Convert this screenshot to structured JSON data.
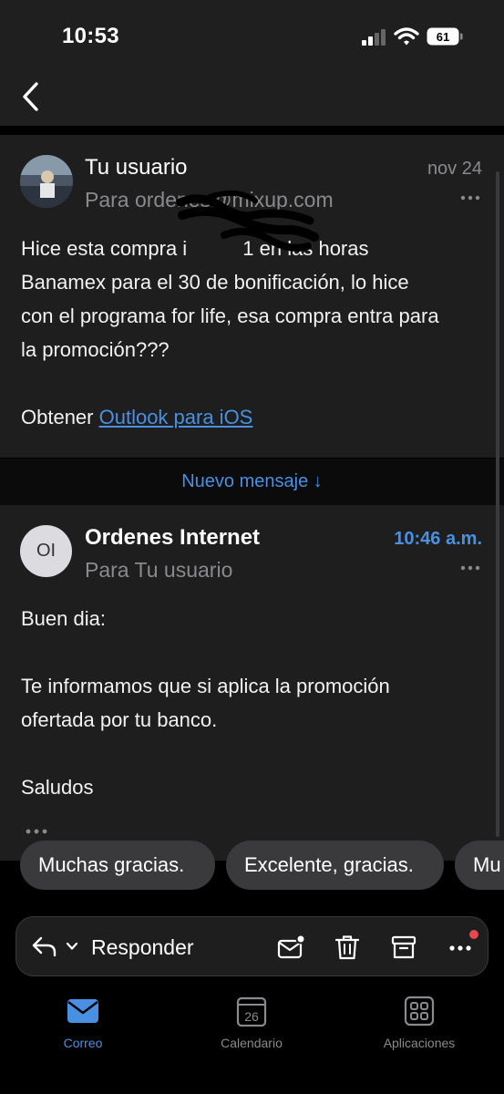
{
  "status_bar": {
    "time": "10:53",
    "battery": "61"
  },
  "messages": [
    {
      "sender": "Tu usuario",
      "recipient": "Para ordenes@mixup.com",
      "date": "nov 24",
      "body_lines": [
        "Hice esta compra i          1 en las horas",
        "Banamex para el 30 de bonificación, lo hice",
        "con el programa for life, esa compra entra para",
        "la promoción???"
      ],
      "footer_prefix": "Obtener ",
      "footer_link": "Outlook para iOS"
    },
    {
      "avatar_initials": "OI",
      "sender": "Ordenes Internet",
      "recipient": "Para Tu usuario",
      "date": "10:46 a.m.",
      "body_lines": [
        "Buen dia:",
        "Te informamos que si aplica la promoción",
        "ofertada por tu banco.",
        "Saludos"
      ]
    }
  ],
  "new_message_label": "Nuevo mensaje ↓",
  "quick_replies": [
    "Muchas gracias.",
    "Excelente, gracias.",
    "Mu"
  ],
  "reply_bar": {
    "reply_label": "Responder"
  },
  "tabs": [
    {
      "label": "Correo",
      "icon": "mail-icon",
      "active": true
    },
    {
      "label": "Calendario",
      "icon": "calendar-icon",
      "day": "26"
    },
    {
      "label": "Aplicaciones",
      "icon": "apps-icon"
    }
  ],
  "colors": {
    "accent": "#4a90e2",
    "card": "#1e1e1e",
    "notification": "#e5484d"
  }
}
